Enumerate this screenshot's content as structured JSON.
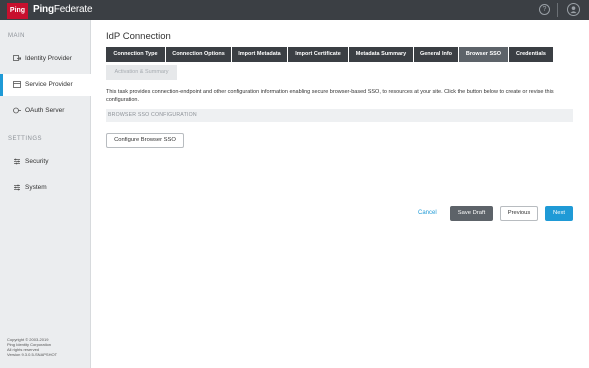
{
  "header": {
    "logo_text": "Ping",
    "brand_bold": "Ping",
    "brand_light": "Federate",
    "help_icon": "question-circle-icon",
    "user_icon": "user-circle-icon"
  },
  "sidebar": {
    "main_heading": "MAIN",
    "settings_heading": "SETTINGS",
    "items": [
      {
        "label": "Identity Provider",
        "icon": "idp-icon"
      },
      {
        "label": "Service Provider",
        "icon": "sp-icon",
        "active": true
      },
      {
        "label": "OAuth Server",
        "icon": "oauth-icon"
      },
      {
        "label": "Security",
        "icon": "security-icon"
      },
      {
        "label": "System",
        "icon": "system-icon"
      }
    ],
    "copyright": [
      "Copyright © 2003-2019",
      "Ping Identity Corporation",
      "All rights reserved",
      "Version 9.3.0.5-SNAPSHOT"
    ]
  },
  "main": {
    "title": "IdP Connection",
    "tabs": [
      {
        "label": "Connection Type"
      },
      {
        "label": "Connection Options"
      },
      {
        "label": "Import Metadata"
      },
      {
        "label": "Import Certificate"
      },
      {
        "label": "Metadata Summary"
      },
      {
        "label": "General Info"
      },
      {
        "label": "Browser SSO",
        "active": true
      },
      {
        "label": "Credentials"
      },
      {
        "label": "Activation & Summary",
        "disabled": true
      }
    ],
    "description": "This task provides connection-endpoint and other configuration information enabling secure browser-based SSO, to resources at your site. Click the button below to create or revise this configuration.",
    "section_label": "BROWSER SSO CONFIGURATION",
    "configure_button": "Configure Browser SSO"
  },
  "footer": {
    "cancel": "Cancel",
    "save_draft": "Save Draft",
    "previous": "Previous",
    "next": "Next"
  },
  "colors": {
    "header_bg": "#3b3f44",
    "accent": "#1f9ad6",
    "logo_red": "#c8102e"
  }
}
